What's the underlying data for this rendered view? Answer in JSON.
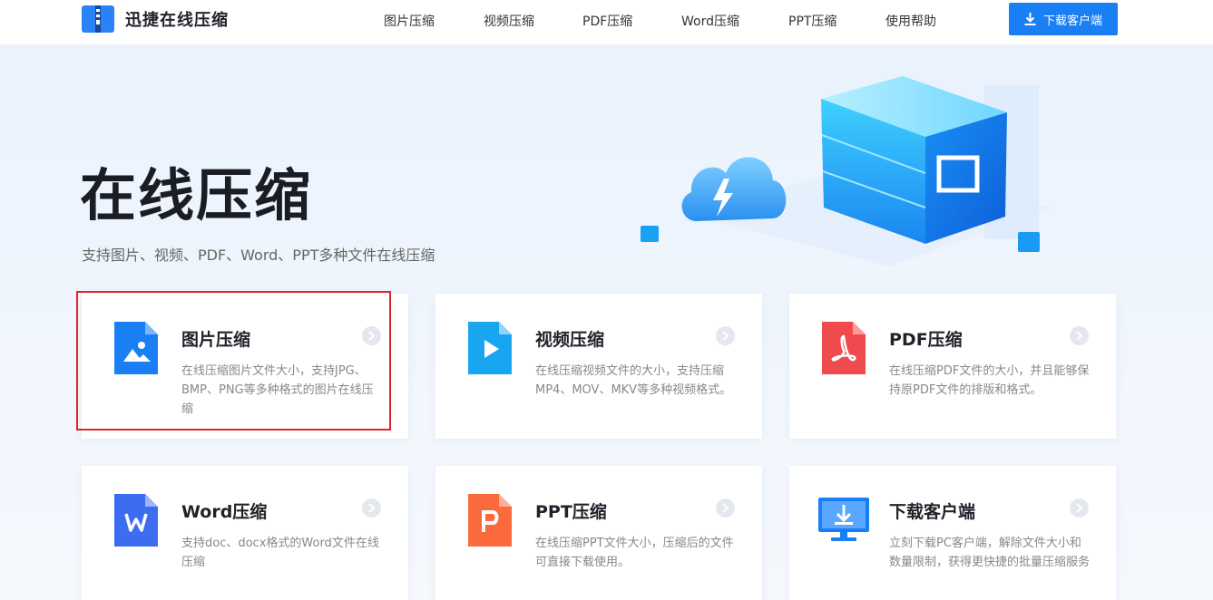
{
  "header": {
    "brand": "迅捷在线压缩",
    "nav": [
      "图片压缩",
      "视频压缩",
      "PDF压缩",
      "Word压缩",
      "PPT压缩",
      "使用帮助"
    ],
    "download_label": "下载客户端"
  },
  "hero": {
    "title": "在线压缩",
    "subtitle": "支持图片、视频、PDF、Word、PPT多种文件在线压缩"
  },
  "cards": [
    {
      "title": "图片压缩",
      "desc": "在线压缩图片文件大小，支持JPG、BMP、PNG等多种格式的图片在线压缩",
      "icon": "image-file-icon",
      "color": "#1a7ef5"
    },
    {
      "title": "视频压缩",
      "desc": "在线压缩视频文件的大小，支持压缩MP4、MOV、MKV等多种视频格式。",
      "icon": "video-file-icon",
      "color": "#19a6f0"
    },
    {
      "title": "PDF压缩",
      "desc": "在线压缩PDF文件的大小，并且能够保持原PDF文件的排版和格式。",
      "icon": "pdf-file-icon",
      "color": "#ef4b4f"
    },
    {
      "title": "Word压缩",
      "desc": "支持doc、docx格式的Word文件在线压缩",
      "icon": "word-file-icon",
      "color": "#3c6cf0"
    },
    {
      "title": "PPT压缩",
      "desc": "在线压缩PPT文件大小，压缩后的文件可直接下载使用。",
      "icon": "ppt-file-icon",
      "color": "#fb6a3c"
    },
    {
      "title": "下载客户端",
      "desc": "立刻下载PC客户端，解除文件大小和数量限制，获得更快捷的批量压缩服务",
      "icon": "desktop-download-icon",
      "color": "#1a7ef5"
    }
  ]
}
